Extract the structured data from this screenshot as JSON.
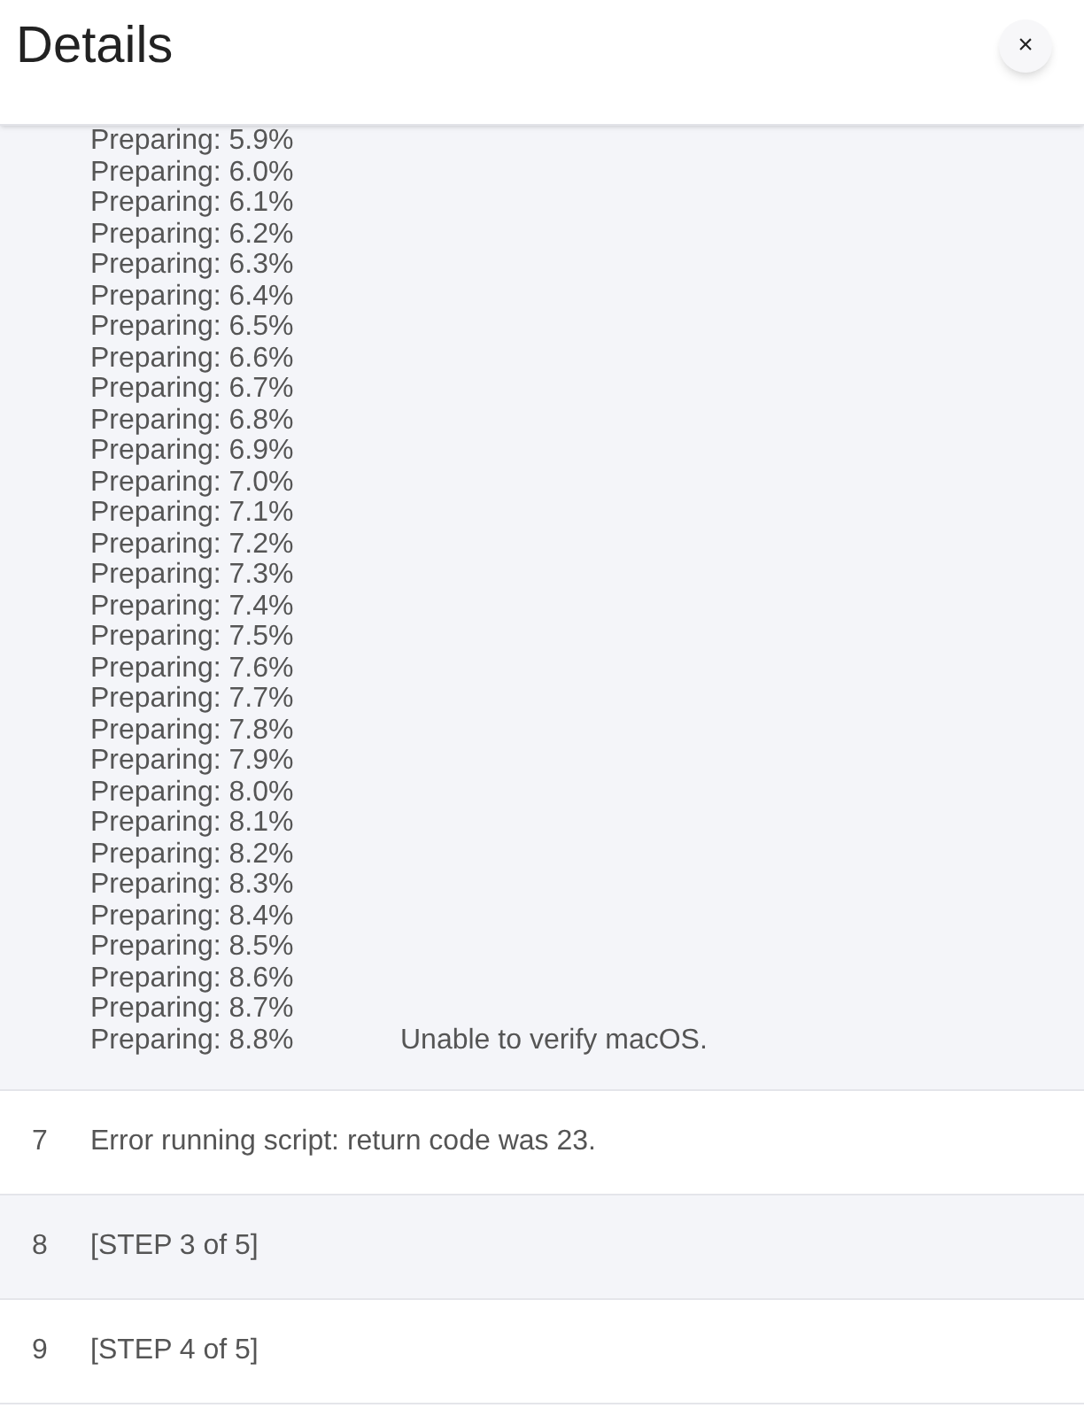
{
  "dialog": {
    "title": "Details",
    "close_label": "×"
  },
  "log": [
    {
      "kind": "progress",
      "lines": [
        "Preparing: 5.9%",
        "Preparing: 6.0%",
        "Preparing: 6.1%",
        "Preparing: 6.2%",
        "Preparing: 6.3%",
        "Preparing: 6.4%",
        "Preparing: 6.5%",
        "Preparing: 6.6%",
        "Preparing: 6.7%",
        "Preparing: 6.8%",
        "Preparing: 6.9%",
        "Preparing: 7.0%",
        "Preparing: 7.1%",
        "Preparing: 7.2%",
        "Preparing: 7.3%",
        "Preparing: 7.4%",
        "Preparing: 7.5%",
        "Preparing: 7.6%",
        "Preparing: 7.7%",
        "Preparing: 7.8%",
        "Preparing: 7.9%",
        "Preparing: 8.0%",
        "Preparing: 8.1%",
        "Preparing: 8.2%",
        "Preparing: 8.3%",
        "Preparing: 8.4%",
        "Preparing: 8.5%",
        "Preparing: 8.6%",
        "Preparing: 8.7%",
        "Preparing: 8.8%"
      ],
      "trailing_note": "Unable to verify macOS."
    },
    {
      "kind": "line",
      "number": "7",
      "text": "Error running script: return code was 23."
    },
    {
      "kind": "line",
      "number": "8",
      "text": "[STEP 3 of 5]"
    },
    {
      "kind": "line",
      "number": "9",
      "text": "[STEP 4 of 5]"
    }
  ]
}
